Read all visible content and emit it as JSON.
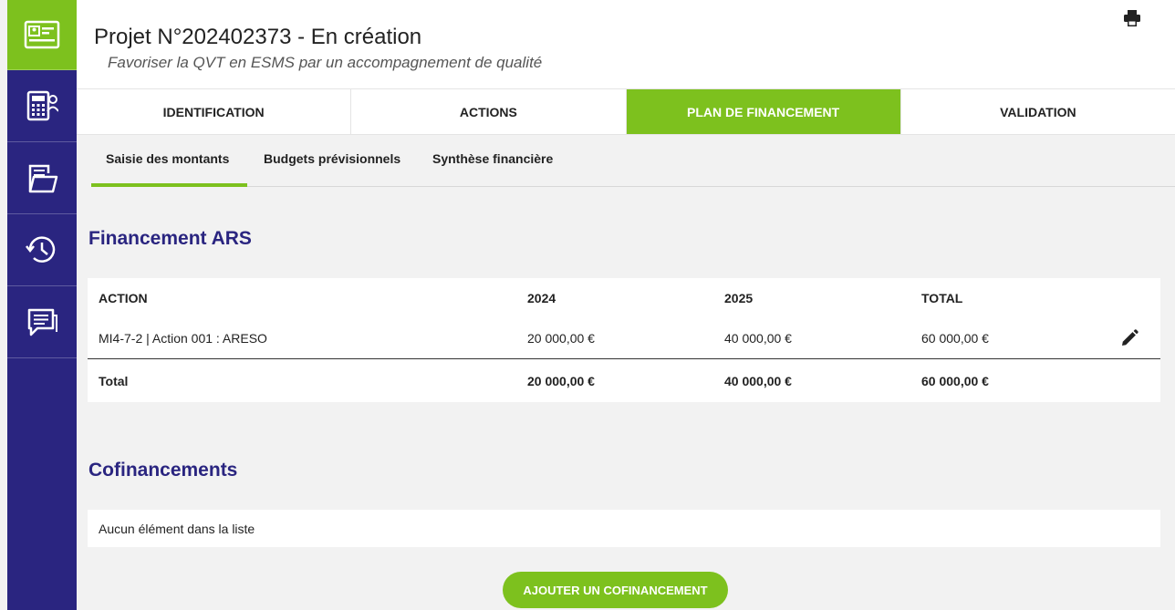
{
  "sidebar": {
    "items": [
      {
        "icon": "id-card-icon",
        "active": true
      },
      {
        "icon": "calculator-user-icon",
        "active": false
      },
      {
        "icon": "folder-documents-icon",
        "active": false
      },
      {
        "icon": "history-icon",
        "active": false
      },
      {
        "icon": "chat-icon",
        "active": false
      }
    ]
  },
  "header": {
    "title": "Projet N°202402373 - En création",
    "subtitle": "Favoriser la QVT en ESMS par un accompagnement de qualité",
    "print_icon": "printer-icon"
  },
  "tabs": [
    {
      "label": "IDENTIFICATION",
      "active": false
    },
    {
      "label": "ACTIONS",
      "active": false
    },
    {
      "label": "PLAN DE FINANCEMENT",
      "active": true
    },
    {
      "label": "VALIDATION",
      "active": false
    }
  ],
  "subtabs": [
    {
      "label": "Saisie des montants",
      "active": true
    },
    {
      "label": "Budgets prévisionnels",
      "active": false
    },
    {
      "label": "Synthèse financière",
      "active": false
    }
  ],
  "financement_ars": {
    "title": "Financement ARS",
    "columns": [
      "ACTION",
      "2024",
      "2025",
      "TOTAL"
    ],
    "rows": [
      {
        "action": "MI4-7-2 | Action 001 : ARESO",
        "y2024": "20 000,00 €",
        "y2025": "40 000,00 €",
        "total": "60 000,00 €"
      }
    ],
    "total_row": {
      "label": "Total",
      "y2024": "20 000,00 €",
      "y2025": "40 000,00 €",
      "total": "60 000,00 €"
    }
  },
  "cofinancements": {
    "title": "Cofinancements",
    "empty_text": "Aucun élément dans la liste",
    "add_button": "AJOUTER UN COFINANCEMENT"
  },
  "colors": {
    "accent_green": "#7dc11e",
    "brand_navy": "#2a2580"
  }
}
